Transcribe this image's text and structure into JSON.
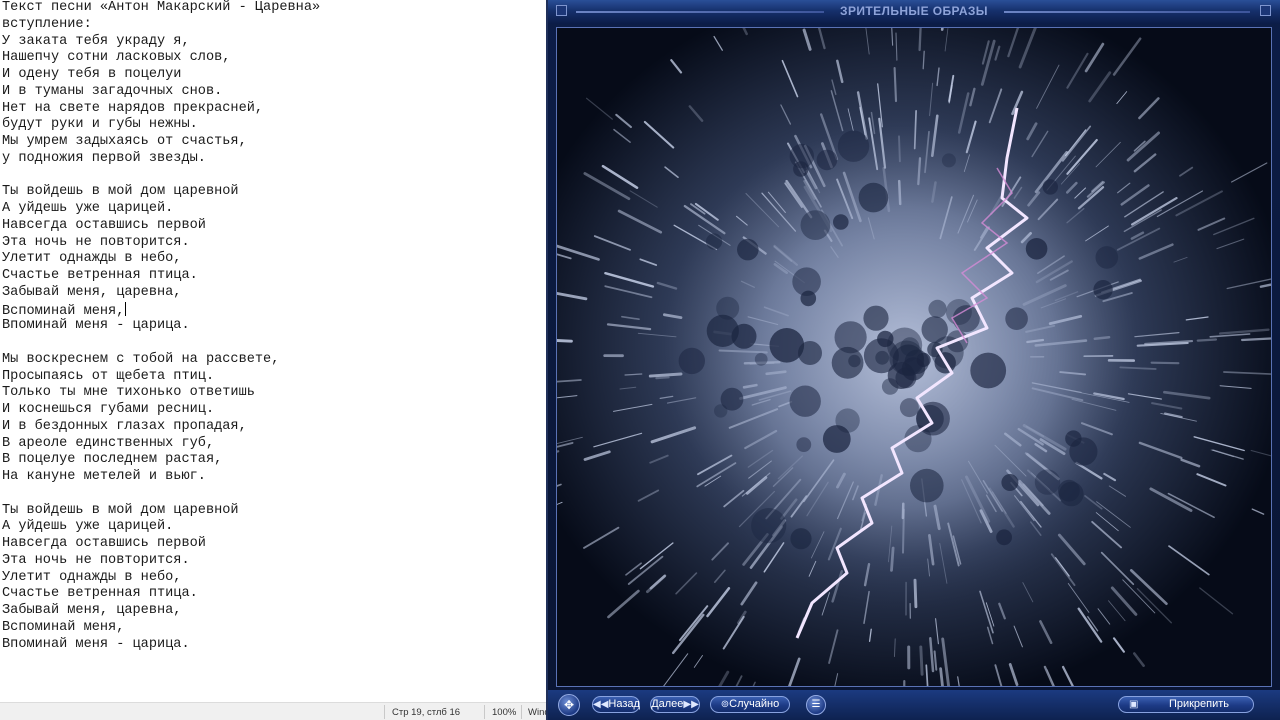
{
  "notepad": {
    "lines": [
      "Текст песни «Антон Макарский - Царевна»",
      "вступление:",
      "У заката тебя украду я,",
      "Нашепчу сотни ласковых слов,",
      "И одену тебя в поцелуи",
      "И в туманы загадочных снов.",
      "Нет на свете нарядов прекрасней,",
      "будут руки и губы нежны.",
      "Мы умрем задыхаясь от счастья,",
      "у подножия первой звезды.",
      "",
      "Ты войдешь в мой дом царевной",
      "А уйдешь уже царицей.",
      "Навсегда оставшись первой",
      "Эта ночь не повторится.",
      "Улетит однажды в небо,",
      "Счастье ветренная птица.",
      "Забывай меня, царевна,",
      "Вспоминай меня,",
      "Впоминай меня - царица.",
      "",
      "Мы воскреснем с тобой на рассвете,",
      "Просыпаясь от щебета птиц.",
      "Только ты мне тихонько ответишь",
      "И коснешься губами ресниц.",
      "И в бездонных глазах пропадая,",
      "В ареоле единственных губ,",
      "В поцелуе последнем растая,",
      "На кануне метелей и вьюг.",
      "",
      "Ты войдешь в мой дом царевной",
      "А уйдешь уже царицей.",
      "Навсегда оставшись первой",
      "Эта ночь не повторится.",
      "Улетит однажды в небо,",
      "Счастье ветренная птица.",
      "Забывай меня, царевна,",
      "Вспоминай меня,",
      "Впоминай меня - царица."
    ],
    "caret_line": 18,
    "status": {
      "position": "Стр 19, стлб 16",
      "zoom": "100%",
      "encoding": "Wind"
    }
  },
  "wmp": {
    "title": "ЗРИТЕЛЬНЫЕ ОБРАЗЫ",
    "controls": {
      "back": "Назад",
      "next": "Далее",
      "random": "Случайно",
      "pin": "Прикрепить"
    },
    "icons": {
      "move": "move-icon",
      "back": "double-left-arrow-icon",
      "next": "double-right-arrow-icon",
      "random": "shuffle-icon",
      "menu": "menu-list-icon",
      "pin": "pin-window-icon"
    },
    "colors": {
      "frame_bg": "#0c1d47",
      "title_text": "#8ea3d9",
      "button_fill": "#1d3b86"
    }
  }
}
